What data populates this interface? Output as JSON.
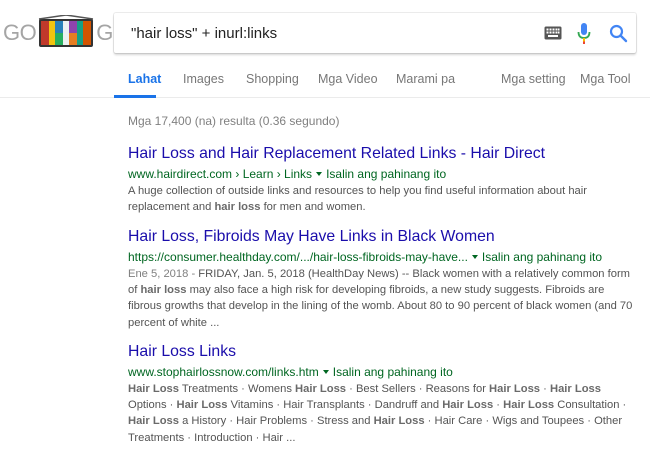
{
  "logo": {
    "left_text": "GO",
    "right_text": "GLE"
  },
  "search": {
    "query": "\"hair loss\" + inurl:links"
  },
  "icons": {
    "keyboard": "keyboard-icon",
    "mic": "microphone-icon",
    "search": "magnifier-icon"
  },
  "colors": {
    "link": "#1a0dab",
    "url": "#006621",
    "accent": "#1a73e8",
    "mic_blue": "#4285f4",
    "mic_red": "#ea4335"
  },
  "tabs": [
    {
      "label": "Lahat"
    },
    {
      "label": "Images"
    },
    {
      "label": "Shopping"
    },
    {
      "label": "Mga Video"
    },
    {
      "label": "Marami pa"
    },
    {
      "label": "Mga setting"
    },
    {
      "label": "Mga Tool"
    }
  ],
  "stats": "Mga 17,400 (na) resulta (0.36 segundo)",
  "results": [
    {
      "title": "Hair Loss and Hair Replacement Related Links - Hair Direct",
      "url": "www.hairdirect.com › Learn › Links",
      "cache": "Isalin ang pahinang ito",
      "snippet": [
        {
          "t": "A huge collection of outside links and resources to help you find useful information about hair replacement and "
        },
        {
          "t": "hair loss",
          "b": true
        },
        {
          "t": " for men and women."
        }
      ]
    },
    {
      "title": "Hair Loss, Fibroids May Have Links in Black Women",
      "url": "https://consumer.healthday.com/.../hair-loss-fibroids-may-have...",
      "cache": "Isalin ang pahinang ito",
      "date": "Ene 5, 2018 - ",
      "snippet": [
        {
          "t": "FRIDAY, Jan. 5, 2018 (HealthDay News) -- Black women with a relatively common form of "
        },
        {
          "t": "hair loss",
          "b": true
        },
        {
          "t": " may also face a high risk for developing fibroids, a new study suggests. Fibroids are fibrous growths that develop in the lining of the womb. About 80 to 90 percent of black women (and 70 percent of white ..."
        }
      ]
    },
    {
      "title": "Hair Loss Links",
      "url": "www.stophairlossnow.com/links.htm",
      "cache": "Isalin ang pahinang ito",
      "snippet": [
        {
          "t": "Hair Loss",
          "b": true
        },
        {
          "t": " Treatments · Womens "
        },
        {
          "t": "Hair Loss",
          "b": true
        },
        {
          "t": " · Best Sellers · Reasons for "
        },
        {
          "t": "Hair Loss",
          "b": true
        },
        {
          "t": " · "
        },
        {
          "t": "Hair Loss",
          "b": true
        },
        {
          "t": " Options · "
        },
        {
          "t": "Hair Loss",
          "b": true
        },
        {
          "t": " Vitamins · Hair Transplants · Dandruff and "
        },
        {
          "t": "Hair Loss",
          "b": true
        },
        {
          "t": " · "
        },
        {
          "t": "Hair Loss",
          "b": true
        },
        {
          "t": " Consultation · "
        },
        {
          "t": "Hair Loss",
          "b": true
        },
        {
          "t": " a History · Hair Problems · Stress and "
        },
        {
          "t": "Hair Loss",
          "b": true
        },
        {
          "t": " · Hair Care · Wigs and Toupees · Other Treatments · Introduction · Hair ..."
        }
      ]
    }
  ]
}
